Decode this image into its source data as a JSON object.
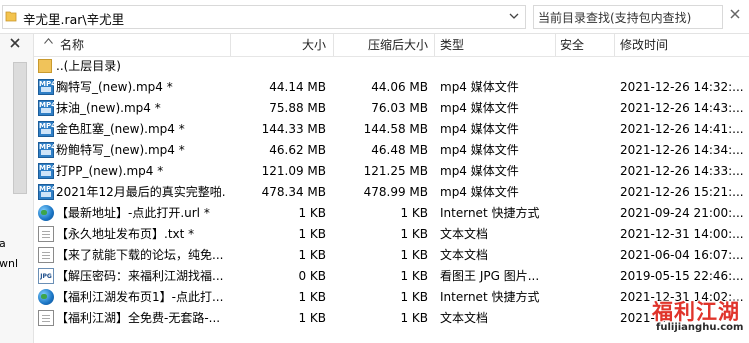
{
  "path": {
    "text": "辛尤里.rar\\辛尤里"
  },
  "search": {
    "placeholder": "当前目录查找(支持包内查找)"
  },
  "left_fragments": [
    "a",
    "wnl"
  ],
  "columns": {
    "name": "名称",
    "size": "大小",
    "packed": "压缩后大小",
    "type": "类型",
    "security": "安全",
    "mtime": "修改时间"
  },
  "parent_row": {
    "name": "..(上层目录)"
  },
  "files": [
    {
      "icon": "mp4-icon",
      "name": "胸特写_(new).mp4 *",
      "size": "44.14 MB",
      "packed": "44.06 MB",
      "type": "mp4 媒体文件",
      "mtime": "2021-12-26 14:32:..."
    },
    {
      "icon": "mp4-icon",
      "name": "抹油_(new).mp4 *",
      "size": "75.88 MB",
      "packed": "76.03 MB",
      "type": "mp4 媒体文件",
      "mtime": "2021-12-26 14:43:..."
    },
    {
      "icon": "mp4-icon",
      "name": "金色肛塞_(new).mp4 *",
      "size": "144.33 MB",
      "packed": "144.58 MB",
      "type": "mp4 媒体文件",
      "mtime": "2021-12-26 14:41:..."
    },
    {
      "icon": "mp4-icon",
      "name": "粉鲍特写_(new).mp4 *",
      "size": "46.62 MB",
      "packed": "46.48 MB",
      "type": "mp4 媒体文件",
      "mtime": "2021-12-26 14:34:..."
    },
    {
      "icon": "mp4-icon",
      "name": "打PP_(new).mp4 *",
      "size": "121.09 MB",
      "packed": "121.25 MB",
      "type": "mp4 媒体文件",
      "mtime": "2021-12-26 14:33:..."
    },
    {
      "icon": "mp4-icon",
      "name": "2021年12月最后的真实完整啪...",
      "size": "478.34 MB",
      "packed": "478.99 MB",
      "type": "mp4 媒体文件",
      "mtime": "2021-12-26 15:21:..."
    },
    {
      "icon": "globe-icon",
      "name": "【最新地址】-点此打开.url *",
      "size": "1 KB",
      "packed": "1 KB",
      "type": "Internet 快捷方式",
      "mtime": "2021-09-24 21:00:..."
    },
    {
      "icon": "text-file-icon",
      "name": "【永久地址发布页】.txt *",
      "size": "1 KB",
      "packed": "1 KB",
      "type": "文本文档",
      "mtime": "2021-12-31 14:00:..."
    },
    {
      "icon": "text-file-icon",
      "name": "【来了就能下载的论坛，纯免...",
      "size": "1 KB",
      "packed": "1 KB",
      "type": "文本文档",
      "mtime": "2021-06-04 16:07:..."
    },
    {
      "icon": "jpg-icon",
      "name": "【解压密码：来福利江湖找福...",
      "size": "0 KB",
      "packed": "1 KB",
      "type": "看图王 JPG 图片...",
      "mtime": "2019-05-15 22:46:..."
    },
    {
      "icon": "globe-icon",
      "name": "【福利江湖发布页1】-点此打...",
      "size": "1 KB",
      "packed": "1 KB",
      "type": "Internet 快捷方式",
      "mtime": "2021-12-31 14:02:..."
    },
    {
      "icon": "text-file-icon",
      "name": "【福利江湖】全免费-无套路-...",
      "size": "1 KB",
      "packed": "1 KB",
      "type": "文本文档",
      "mtime": "2021-..."
    }
  ],
  "watermark": {
    "title": "福利江湖",
    "url": "fulijianghu.com"
  },
  "colors": {
    "mp4_icon": "#2f7fc6",
    "watermark": "#e0342b"
  }
}
